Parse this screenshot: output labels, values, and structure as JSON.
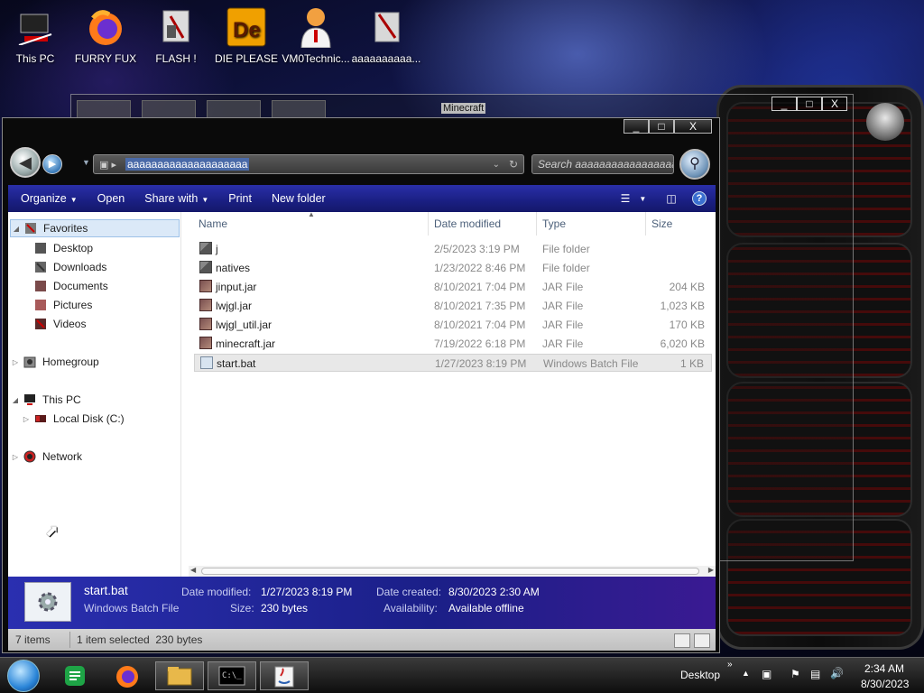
{
  "desktop": {
    "icons": [
      {
        "label": "This PC",
        "icon": "computer-icon"
      },
      {
        "label": "FURRY FUX",
        "icon": "firefox-icon"
      },
      {
        "label": "FLASH !",
        "icon": "flash-icon"
      },
      {
        "label": "DIE PLEASE",
        "icon": "die-app-icon"
      },
      {
        "label": "VM0Technic...",
        "icon": "doctor-avatar-icon"
      },
      {
        "label": "aaaaaaaaaa...",
        "icon": "app-icon"
      }
    ]
  },
  "background_window": {
    "title": "Minecraft",
    "controls": {
      "minimize": "_",
      "maximize": "□",
      "close": "X"
    }
  },
  "explorer": {
    "controls": {
      "minimize": "_",
      "maximize": "□",
      "close": "X"
    },
    "address": {
      "path": "aaaaaaaaaaaaaaaaaaaa"
    },
    "search": {
      "placeholder": "Search aaaaaaaaaaaaaaaaaaaa"
    },
    "toolbar": {
      "organize": "Organize",
      "open": "Open",
      "share_with": "Share with",
      "print": "Print",
      "new_folder": "New folder"
    },
    "nav": {
      "favorites": "Favorites",
      "desktop": "Desktop",
      "downloads": "Downloads",
      "documents": "Documents",
      "pictures": "Pictures",
      "videos": "Videos",
      "homegroup": "Homegroup",
      "this_pc": "This PC",
      "local_disk": "Local Disk (C:)",
      "network": "Network"
    },
    "columns": {
      "name": "Name",
      "date_modified": "Date modified",
      "type": "Type",
      "size": "Size"
    },
    "files": [
      {
        "name": "j",
        "date": "2/5/2023 3:19 PM",
        "type": "File folder",
        "size": "",
        "icon": "folder-icon"
      },
      {
        "name": "natives",
        "date": "1/23/2022 8:46 PM",
        "type": "File folder",
        "size": "",
        "icon": "folder-icon"
      },
      {
        "name": "jinput.jar",
        "date": "8/10/2021 7:04 PM",
        "type": "JAR File",
        "size": "204 KB",
        "icon": "jar-file-icon"
      },
      {
        "name": "lwjgl.jar",
        "date": "8/10/2021 7:35 PM",
        "type": "JAR File",
        "size": "1,023 KB",
        "icon": "jar-file-icon"
      },
      {
        "name": "lwjgl_util.jar",
        "date": "8/10/2021 7:04 PM",
        "type": "JAR File",
        "size": "170 KB",
        "icon": "jar-file-icon"
      },
      {
        "name": "minecraft.jar",
        "date": "7/19/2022 6:18 PM",
        "type": "JAR File",
        "size": "6,020 KB",
        "icon": "jar-file-icon"
      },
      {
        "name": "start.bat",
        "date": "1/27/2023 8:19 PM",
        "type": "Windows Batch File",
        "size": "1 KB",
        "icon": "batch-file-icon"
      }
    ],
    "details": {
      "name": "start.bat",
      "type": "Windows Batch File",
      "date_modified_label": "Date modified:",
      "date_modified": "1/27/2023 8:19 PM",
      "size_label": "Size:",
      "size": "230 bytes",
      "date_created_label": "Date created:",
      "date_created": "8/30/2023 2:30 AM",
      "availability_label": "Availability:",
      "availability": "Available offline"
    },
    "status": {
      "items": "7 items",
      "selection": "1 item selected  230 bytes"
    }
  },
  "taskbar": {
    "desktop_label": "Desktop",
    "time": "2:34 AM",
    "date": "8/30/2023"
  }
}
